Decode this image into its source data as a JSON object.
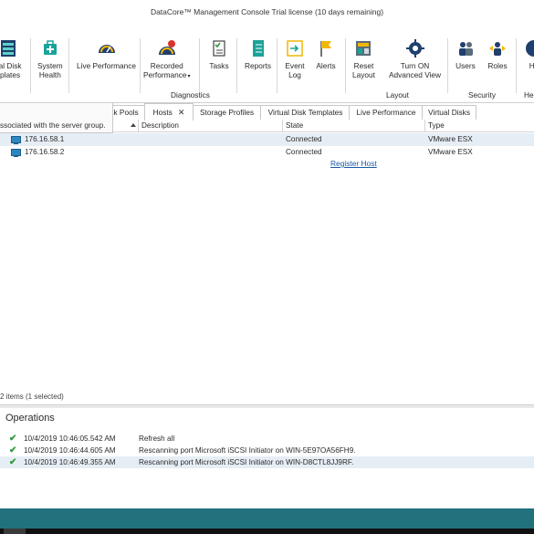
{
  "title": "DataCore™ Management Console    Trial license (10 days remaining)",
  "ribbon": {
    "buttons": [
      {
        "label1": "ual Disk",
        "label2": "nplates",
        "icon": "virtual-disk-templates-icon"
      },
      {
        "label1": "System",
        "label2": "Health",
        "icon": "system-health-icon"
      },
      {
        "label1": "Live Performance",
        "label2": "",
        "icon": "live-performance-icon"
      },
      {
        "label1": "Recorded",
        "label2": "Performance",
        "icon": "recorded-performance-icon"
      },
      {
        "label1": "Tasks",
        "label2": "",
        "icon": "tasks-icon"
      },
      {
        "label1": "Reports",
        "label2": "",
        "icon": "reports-icon"
      },
      {
        "label1": "Event",
        "label2": "Log",
        "icon": "event-log-icon"
      },
      {
        "label1": "Alerts",
        "label2": "",
        "icon": "alerts-icon"
      },
      {
        "label1": "Reset",
        "label2": "Layout",
        "icon": "reset-layout-icon"
      },
      {
        "label1": "Turn ON",
        "label2": "Advanced View",
        "icon": "advanced-view-icon"
      },
      {
        "label1": "Users",
        "label2": "",
        "icon": "users-icon"
      },
      {
        "label1": "Roles",
        "label2": "",
        "icon": "roles-icon"
      },
      {
        "label1": "He",
        "label2": "",
        "icon": "help-icon"
      }
    ],
    "groups": [
      "Diagnostics",
      "Layout",
      "Security",
      "He"
    ]
  },
  "tabs": [
    {
      "label": "sk Pools"
    },
    {
      "label": "Hosts"
    },
    {
      "label": "Storage Profiles"
    },
    {
      "label": "Virtual Disk Templates"
    },
    {
      "label": "Live Performance"
    },
    {
      "label": "Virtual Disks"
    }
  ],
  "left_panel_text": "ssociated with the server group.",
  "grid": {
    "columns": [
      "Description",
      "State",
      "Type"
    ],
    "rows": [
      {
        "name": "176.16.58.1",
        "description": "",
        "state": "Connected",
        "type": "VMware ESX"
      },
      {
        "name": "176.16.58.2",
        "description": "",
        "state": "Connected",
        "type": "VMware ESX"
      }
    ],
    "register_link": "Register Host"
  },
  "status_text": "2 items (1 selected)",
  "operations": {
    "title": "Operations",
    "rows": [
      {
        "time": "10/4/2019 10:46:05.542 AM",
        "message": "Refresh all"
      },
      {
        "time": "10/4/2019 10:46:44.605 AM",
        "message": "Rescanning port Microsoft iSCSI Initiator on WIN-5E97OA56FH9."
      },
      {
        "time": "10/4/2019 10:46:49.355 AM",
        "message": "Rescanning port Microsoft iSCSI Initiator on WIN-D8CTL8JJ9RF."
      }
    ]
  },
  "colors": {
    "accent": "#22727e",
    "selection": "#e6eef5",
    "link": "#1a5aa8",
    "check": "#2e9a3a"
  }
}
